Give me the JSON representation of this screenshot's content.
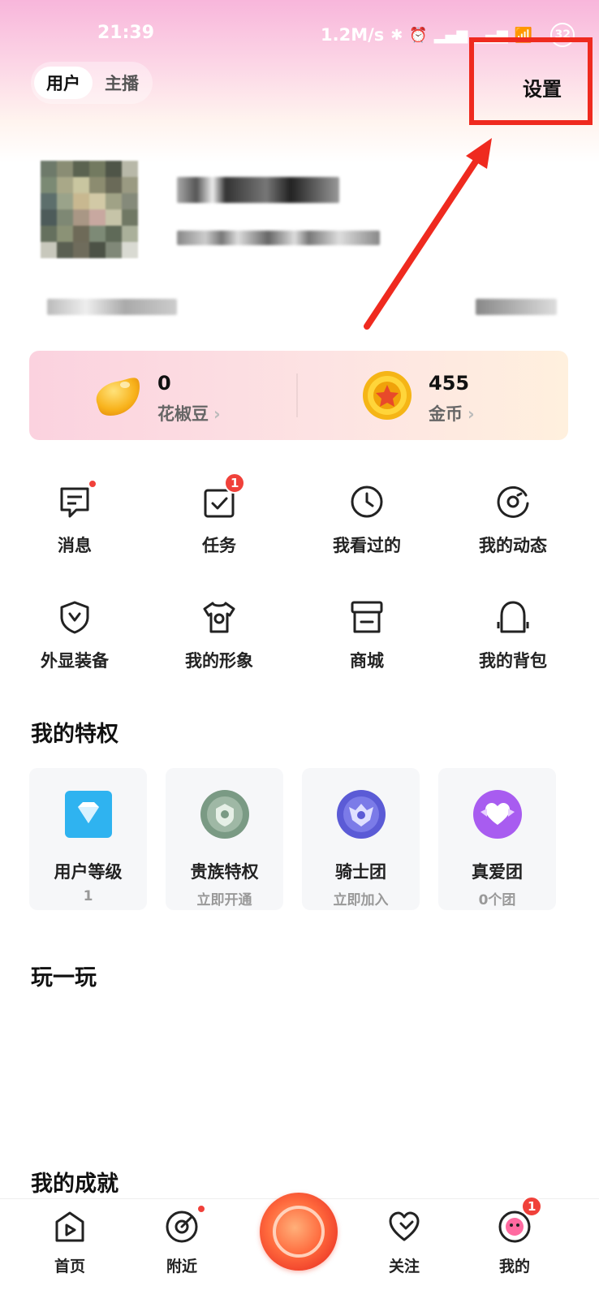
{
  "status_bar": {
    "time": "21:39",
    "speed": "1.2M/s",
    "battery": "32"
  },
  "header": {
    "role_tabs": [
      {
        "label": "用户"
      },
      {
        "label": "主播"
      }
    ],
    "settings_label": "设置"
  },
  "wallet": {
    "beans": {
      "value": "0",
      "label": "花椒豆"
    },
    "coins": {
      "value": "455",
      "label": "金币"
    }
  },
  "menu": [
    {
      "label": "消息",
      "icon": "message-icon",
      "badge": "dot"
    },
    {
      "label": "任务",
      "icon": "task-icon",
      "badge": "1"
    },
    {
      "label": "我看过的",
      "icon": "clock-icon"
    },
    {
      "label": "我的动态",
      "icon": "moments-icon"
    },
    {
      "label": "外显装备",
      "icon": "shield-icon"
    },
    {
      "label": "我的形象",
      "icon": "tshirt-icon"
    },
    {
      "label": "商城",
      "icon": "store-icon"
    },
    {
      "label": "我的背包",
      "icon": "backpack-icon"
    }
  ],
  "privileges": {
    "title": "我的特权",
    "items": [
      {
        "name": "用户等级",
        "sub": "1",
        "icon": "diamond-icon",
        "color": "#2fb3f0"
      },
      {
        "name": "贵族特权",
        "sub": "立即开通",
        "icon": "noble-emblem-icon",
        "color": "#7a9a84"
      },
      {
        "name": "骑士团",
        "sub": "立即加入",
        "icon": "knight-emblem-icon",
        "color": "#5b5bd6"
      },
      {
        "name": "真爱团",
        "sub": "0个团",
        "icon": "heart-emblem-icon",
        "color": "#a85cf0"
      }
    ]
  },
  "play": {
    "title": "玩一玩"
  },
  "achievements": {
    "title": "我的成就"
  },
  "bottom_nav": {
    "items": [
      {
        "label": "首页",
        "icon": "home-play-icon"
      },
      {
        "label": "附近",
        "icon": "nearby-icon",
        "badge": "dot"
      },
      {
        "label": "",
        "icon": "live-button-icon"
      },
      {
        "label": "关注",
        "icon": "heart-icon"
      },
      {
        "label": "我的",
        "icon": "profile-icon",
        "badge": "1"
      }
    ]
  },
  "colors": {
    "accent_red": "#f0413a",
    "highlight_box": "#ef2a1f"
  }
}
